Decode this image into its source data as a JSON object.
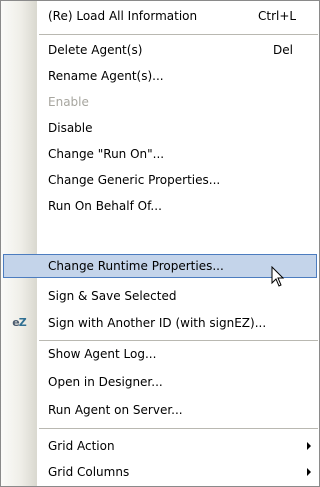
{
  "menu": {
    "items": [
      {
        "label": "(Re) Load All Information",
        "shortcut": "Ctrl+L"
      },
      {
        "label": "Delete Agent(s)",
        "shortcut": "Del"
      },
      {
        "label": "Rename Agent(s)..."
      },
      {
        "label": "Enable",
        "disabled": true
      },
      {
        "label": "Disable"
      },
      {
        "label": "Change \"Run On\"..."
      },
      {
        "label": "Change Generic Properties..."
      },
      {
        "label": "Run On Behalf Of..."
      },
      {
        "label": "Change Runtime Properties...",
        "highlighted": true
      },
      {
        "label": "Sign & Save Selected"
      },
      {
        "label": "Sign with Another ID (with signEZ)...",
        "icon": "signez-icon",
        "icon_text": "eZ"
      },
      {
        "label": "Show Agent Log..."
      },
      {
        "label": "Open in Designer..."
      },
      {
        "label": "Run Agent on Server..."
      },
      {
        "label": "Grid Action",
        "submenu": true
      },
      {
        "label": "Grid Columns",
        "submenu": true
      }
    ]
  },
  "colors": {
    "highlight_fill": "#c4d4ea",
    "highlight_border": "#4c7cbf",
    "disabled_text": "#a7a69f"
  }
}
